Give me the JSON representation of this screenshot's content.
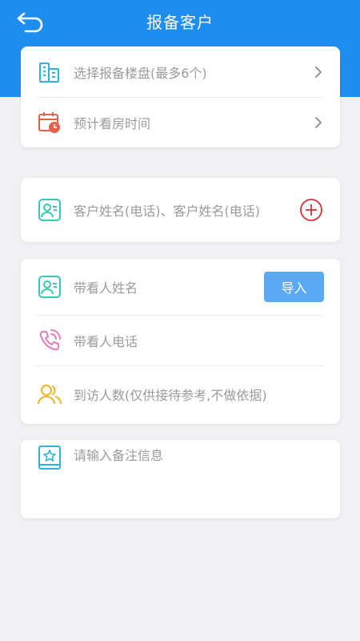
{
  "header": {
    "title": "报备客户",
    "back_icon": "back-arrow-icon",
    "background_color": "#1e8df0"
  },
  "project_card": {
    "items": [
      {
        "label": "选择报备楼盘(最多6个)",
        "icon": "building-icon",
        "action_icon": "chevron-right-icon"
      },
      {
        "label": "预计看房时间",
        "icon": "calendar-clock-icon",
        "action_icon": "chevron-right-icon"
      }
    ]
  },
  "customer_card": {
    "label": "客户姓名(电话)、客户姓名(电话)",
    "icon": "contact-card-icon",
    "action_icon": "add-circle-icon"
  },
  "agent_card": {
    "name_label": "带看人姓名",
    "import_button": "导入",
    "phone_label": "带看人电话",
    "visitors_label": "到访人数(仅供接待参考,不做依据)"
  },
  "remark": {
    "placeholder": "请输入备注信息",
    "icon": "star-note-icon"
  },
  "colors": {
    "accent": "#1e8df0",
    "button": "#5aa9f2",
    "placeholder_text": "#9b9b9b",
    "add_icon": "#d0343a"
  }
}
